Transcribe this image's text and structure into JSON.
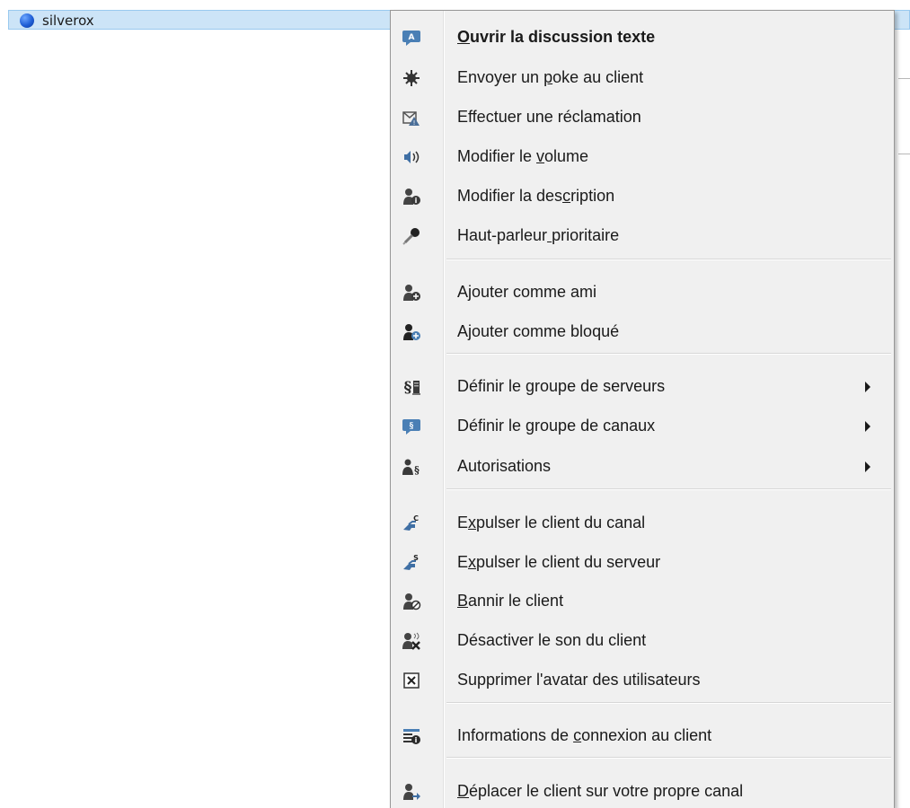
{
  "tree": {
    "selected_client": {
      "name": "silverox",
      "status_color": "#1f5fd6"
    }
  },
  "menu": {
    "items": [
      {
        "label": "Ouvrir la discussion texte",
        "underline_index": 0,
        "bold": true,
        "icon": "chat-bubble-icon",
        "submenu": false
      },
      {
        "label": "Envoyer un poke au client",
        "underline_index": 11,
        "bold": false,
        "icon": "poke-icon",
        "submenu": false
      },
      {
        "label": "Effectuer une réclamation",
        "underline_index": -1,
        "bold": false,
        "icon": "complaint-icon",
        "submenu": false
      },
      {
        "label": "Modifier le volume",
        "underline_index": 12,
        "bold": false,
        "icon": "volume-icon",
        "submenu": false
      },
      {
        "label": "Modifier la description",
        "underline_index": 15,
        "bold": false,
        "icon": "user-info-icon",
        "submenu": false
      },
      {
        "label": "Haut-parleur prioritaire",
        "underline_index": 12,
        "bold": false,
        "icon": "microphone-icon",
        "submenu": false
      },
      {
        "label": "Ajouter comme ami",
        "underline_index": -1,
        "bold": false,
        "icon": "add-friend-icon",
        "submenu": false
      },
      {
        "label": "Ajouter comme bloqué",
        "underline_index": -1,
        "bold": false,
        "icon": "add-blocked-icon",
        "submenu": false
      },
      {
        "label": "Définir le groupe de serveurs",
        "underline_index": -1,
        "bold": false,
        "icon": "server-group-icon",
        "submenu": true
      },
      {
        "label": "Définir le groupe de canaux",
        "underline_index": -1,
        "bold": false,
        "icon": "channel-group-icon",
        "submenu": true
      },
      {
        "label": "Autorisations",
        "underline_index": -1,
        "bold": false,
        "icon": "permissions-icon",
        "submenu": true
      },
      {
        "label": "Expulser le client du canal",
        "underline_index": 1,
        "bold": false,
        "icon": "kick-channel-icon",
        "submenu": false
      },
      {
        "label": "Expulser le client du serveur",
        "underline_index": 1,
        "bold": false,
        "icon": "kick-server-icon",
        "submenu": false
      },
      {
        "label": "Bannir le client",
        "underline_index": 0,
        "bold": false,
        "icon": "ban-icon",
        "submenu": false
      },
      {
        "label": "Désactiver le son du client",
        "underline_index": -1,
        "bold": false,
        "icon": "mute-client-icon",
        "submenu": false
      },
      {
        "label": "Supprimer l'avatar des utilisateurs",
        "underline_index": -1,
        "bold": false,
        "icon": "delete-avatar-icon",
        "submenu": false
      },
      {
        "label": "Informations de connexion au client",
        "underline_index": 16,
        "bold": false,
        "icon": "connection-info-icon",
        "submenu": false
      },
      {
        "label": "Déplacer le client sur votre propre canal",
        "underline_index": 0,
        "bold": false,
        "icon": "move-client-icon",
        "submenu": false
      }
    ]
  }
}
